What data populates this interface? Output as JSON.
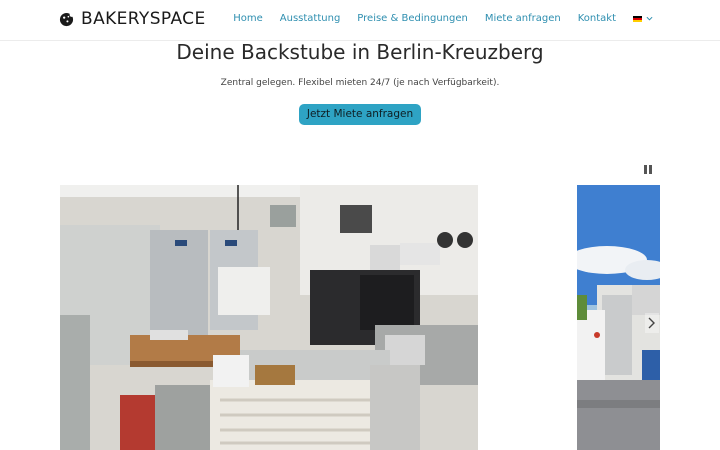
{
  "header": {
    "logo_text": "BAKERYSPACE",
    "nav": [
      {
        "label": "Home"
      },
      {
        "label": "Ausstattung"
      },
      {
        "label": "Preise & Bedingungen"
      },
      {
        "label": "Miete anfragen"
      },
      {
        "label": "Kontakt"
      }
    ],
    "language_flag": "de-flag-icon"
  },
  "hero": {
    "title": "Deine Backstube in Berlin-Kreuzberg",
    "subtitle": "Zentral gelegen. Flexibel mieten 24/7 (je nach Verfügbarkeit).",
    "cta_label": "Jetzt Miete anfragen"
  },
  "slider": {
    "pause_icon": "pause-icon",
    "slides": [
      {
        "description_icon": "bakery-kitchen-photo"
      },
      {
        "description_icon": "building-exterior-photo"
      }
    ]
  },
  "colors": {
    "accent": "#2ea3c4",
    "nav_link": "#2f8fb0",
    "title": "#2a2a2a"
  }
}
